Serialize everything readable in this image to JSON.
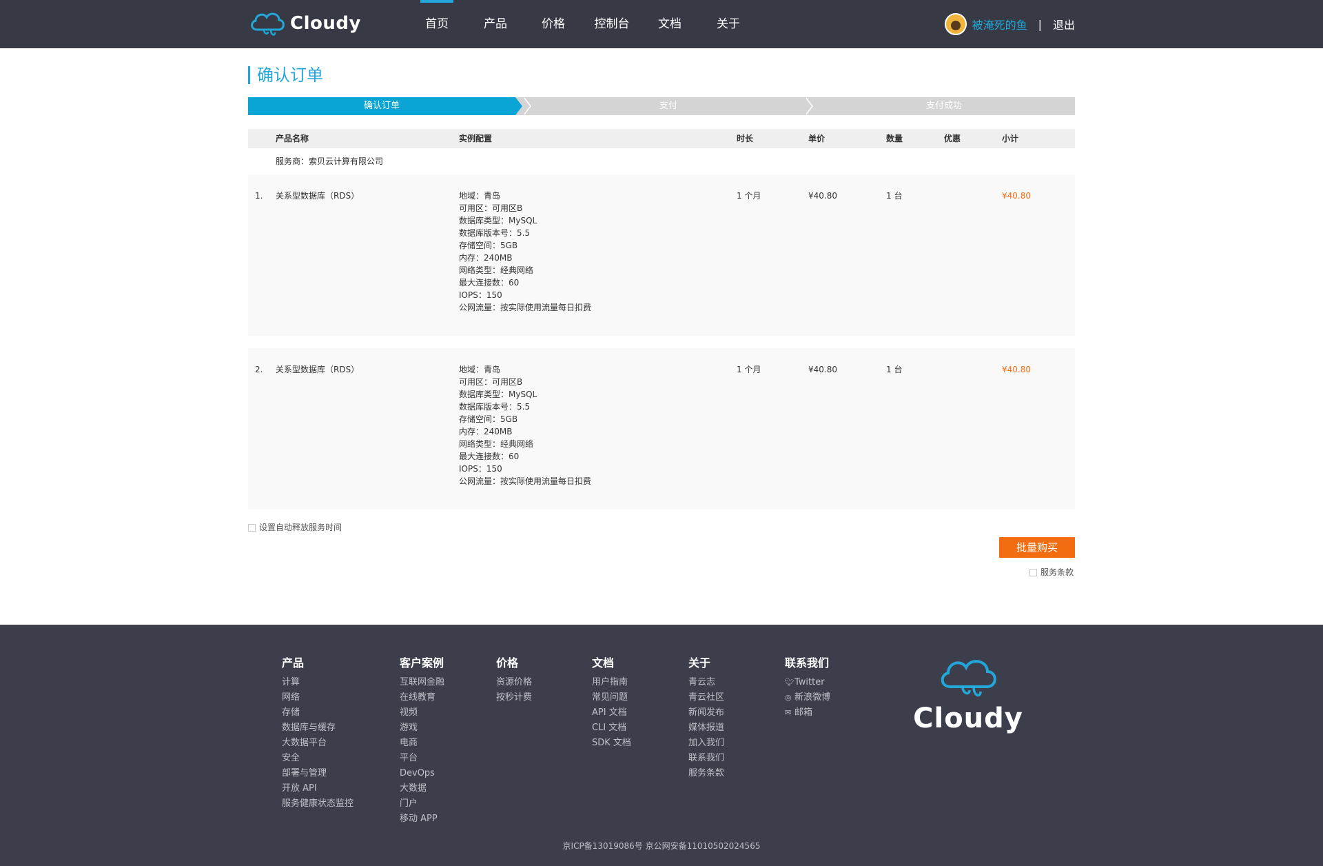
{
  "header": {
    "logo_text": "Cloudy",
    "nav": [
      "首页",
      "产品",
      "价格",
      "控制台",
      "文档",
      "关于"
    ],
    "username": "被淹死的鱼",
    "separator": "|",
    "logout": "退出"
  },
  "page_title": "确认订单",
  "steps": [
    "确认订单",
    "支付",
    "支付成功"
  ],
  "table": {
    "headers": {
      "name": "产品名称",
      "config": "实例配置",
      "duration": "时长",
      "unit_price": "单价",
      "quantity": "数量",
      "discount": "优惠",
      "subtotal": "小计"
    },
    "vendor": "服务商：索贝云计算有限公司",
    "rows": [
      {
        "index": "1.",
        "name": "关系型数据库（RDS）",
        "config": [
          "地域：青岛",
          "可用区：可用区B",
          "数据库类型：MySQL",
          "数据库版本号：5.5",
          "存储空间：5GB",
          "内存：240MB",
          "网络类型：经典网络",
          "最大连接数：60",
          "IOPS：150",
          "公网流量：按实际使用流量每日扣费"
        ],
        "duration": "1 个月",
        "unit_price": "¥40.80",
        "quantity": "1 台",
        "discount": "",
        "subtotal": "¥40.80"
      },
      {
        "index": "2.",
        "name": "关系型数据库（RDS）",
        "config": [
          "地域：青岛",
          "可用区：可用区B",
          "数据库类型：MySQL",
          "数据库版本号：5.5",
          "存储空间：5GB",
          "内存：240MB",
          "网络类型：经典网络",
          "最大连接数：60",
          "IOPS：150",
          "公网流量：按实际使用流量每日扣费"
        ],
        "duration": "1 个月",
        "unit_price": "¥40.80",
        "quantity": "1 台",
        "discount": "",
        "subtotal": "¥40.80"
      }
    ]
  },
  "options": {
    "auto_release_label": "设置自动释放服务时间",
    "buy_button": "批量购买",
    "terms_label": "服务条款"
  },
  "footer": {
    "columns": [
      {
        "title": "产品",
        "items": [
          "计算",
          "网络",
          "存储",
          "数据库与缓存",
          "大数据平台",
          "安全",
          "部署与管理",
          "开放 API",
          "服务健康状态监控"
        ]
      },
      {
        "title": "客户案例",
        "items": [
          "互联网金融",
          "在线教育",
          "视频",
          "游戏",
          "电商",
          "平台",
          "DevOps",
          "大数据",
          "门户",
          "移动 APP"
        ]
      },
      {
        "title": "价格",
        "items": [
          "资源价格",
          "按秒计费"
        ]
      },
      {
        "title": "文档",
        "items": [
          "用户指南",
          "常见问题",
          "API 文档",
          "CLI 文档",
          "SDK 文档"
        ]
      },
      {
        "title": "关于",
        "items": [
          "青云志",
          "青云社区",
          "新闻发布",
          "媒体报道",
          "加入我们",
          "联系我们",
          "服务条款"
        ]
      },
      {
        "title": "联系我们",
        "items": [
          "Twitter",
          "新浪微博",
          "邮箱"
        ]
      }
    ],
    "contact_icons": [
      "twitter-icon",
      "weibo-icon",
      "mail-icon"
    ],
    "logo_text": "Cloudy",
    "icp": "京ICP备13019086号 京公网安备11010502024565"
  },
  "colors": {
    "header_bg": "#373945",
    "accent": "#22a7d8",
    "step_active": "#0ba5d5",
    "buy_button": "#f26d12",
    "footer_bg": "#3d3e4c"
  }
}
